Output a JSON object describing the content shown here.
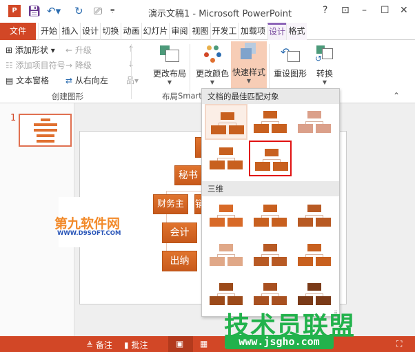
{
  "app": {
    "title": "演示文稿1 - Microsoft PowerPoint",
    "help": "?",
    "brand_color": "#d24726",
    "contextual_color": "#7b4fa0"
  },
  "tabs": [
    "文件",
    "开始",
    "插入",
    "设计",
    "切换",
    "动画",
    "幻灯片",
    "审阅",
    "视图",
    "开发工",
    "加载项",
    "设计",
    "格式"
  ],
  "ribbon": {
    "create": {
      "add_shape": "添加形状",
      "add_bullet": "添加项目符号",
      "text_pane": "文本窗格",
      "promote": "升级",
      "demote": "降级",
      "rtl": "从右向左",
      "label": "创建图形"
    },
    "layout": {
      "change_layout": "更改布局",
      "label": "布局"
    },
    "styles": {
      "change_colors": "更改颜色",
      "quick_styles": "快速样式",
      "label": "SmartA"
    },
    "reset": {
      "reset_graphic": "重设图形",
      "convert": "转换"
    }
  },
  "gallery": {
    "section1": "文档的最佳匹配对象",
    "section2": "三维"
  },
  "slides": {
    "number": "1"
  },
  "diagram": {
    "nodes": [
      "秘书",
      "财务主管",
      "销",
      "会计",
      "出纳"
    ]
  },
  "status": {
    "notes": "备注",
    "comments": "批注"
  },
  "watermarks": {
    "site1": "第九软件网",
    "site1_url": "WWW.D9SOFT.COM",
    "site2": "技术员联盟",
    "site2_url": "www.jsgho.com"
  }
}
